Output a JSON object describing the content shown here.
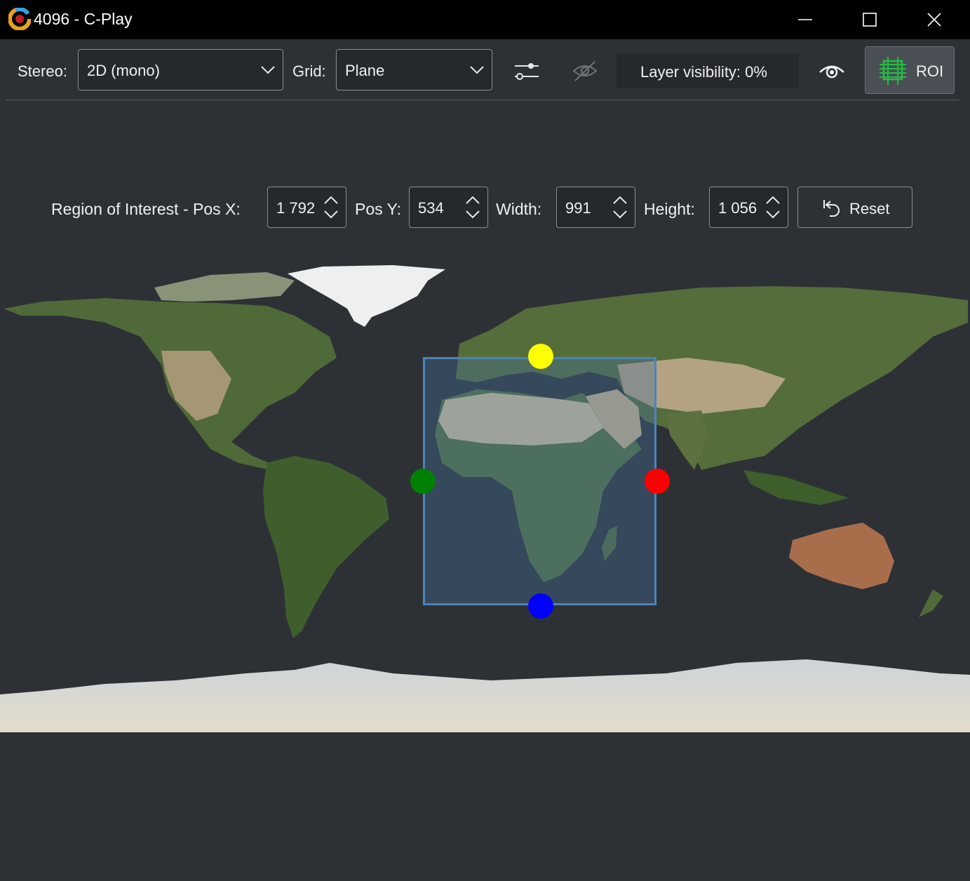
{
  "window": {
    "title": "4096 - C-Play"
  },
  "toolbar": {
    "stereo_label": "Stereo:",
    "stereo_value": "2D (mono)",
    "grid_label": "Grid:",
    "grid_value": "Plane",
    "layer_visibility": "Layer visibility: 0%",
    "roi_label": "ROI"
  },
  "roi_panel": {
    "title_label": "Region of Interest - Pos X:",
    "pos_x": "1 792",
    "pos_y_label": "Pos Y:",
    "pos_y": "534",
    "width_label": "Width:",
    "width": "991",
    "height_label": "Height:",
    "height": "1 056",
    "reset_label": "Reset"
  },
  "colors": {
    "roi_border": "#4d83b8",
    "handle_top": "#ffff00",
    "handle_left": "#008000",
    "handle_right": "#ff0000",
    "handle_bottom": "#0000ff",
    "roi_icon": "#20c040"
  }
}
